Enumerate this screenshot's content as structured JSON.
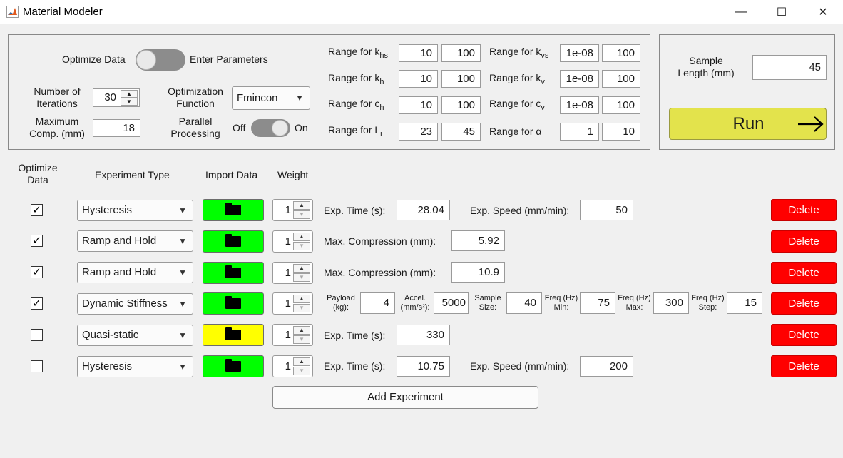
{
  "window": {
    "title": "Material Modeler",
    "min": "—",
    "max": "☐",
    "close": "✕"
  },
  "settings": {
    "mode_toggle": {
      "left_label": "Optimize Data",
      "right_label": "Enter Parameters"
    },
    "iterations": {
      "label_1": "Number of",
      "label_2": "Iterations",
      "value": "30"
    },
    "max_comp": {
      "label_1": "Maximum",
      "label_2": "Comp. (mm)",
      "value": "18"
    },
    "opt_function": {
      "label_1": "Optimization",
      "label_2": "Function",
      "value": "Fmincon"
    },
    "parallel": {
      "label_1": "Parallel",
      "label_2": "Processing",
      "off": "Off",
      "on": "On"
    }
  },
  "ranges": [
    {
      "label": "Range for k",
      "sub": "hs",
      "min": "10",
      "max": "100"
    },
    {
      "label": "Range for k",
      "sub": "h",
      "min": "10",
      "max": "100"
    },
    {
      "label": "Range for c",
      "sub": "h",
      "min": "10",
      "max": "100"
    },
    {
      "label": "Range for L",
      "sub": "i",
      "min": "23",
      "max": "45"
    },
    {
      "label": "Range for k",
      "sub": "vs",
      "min": "1e-08",
      "max": "100"
    },
    {
      "label": "Range for k",
      "sub": "v",
      "min": "1e-08",
      "max": "100"
    },
    {
      "label": "Range for c",
      "sub": "v",
      "min": "1e-08",
      "max": "100"
    },
    {
      "label": "Range for α",
      "sub": "",
      "min": "1",
      "max": "10"
    }
  ],
  "sample": {
    "label_1": "Sample",
    "label_2": "Length (mm)",
    "value": "45"
  },
  "run": {
    "label": "Run",
    "arrow": "→"
  },
  "table_headers": {
    "optimize_1": "Optimize",
    "optimize_2": "Data",
    "type": "Experiment Type",
    "import": "Import Data",
    "weight": "Weight"
  },
  "experiments": [
    {
      "checked": "✓",
      "type": "Hysteresis",
      "weight": "1",
      "color": "#00ff00",
      "params": [
        {
          "label": "Exp. Time (s):",
          "value": "28.04"
        },
        {
          "label": "Exp. Speed (mm/min):",
          "value": "50"
        }
      ],
      "delete": "Delete"
    },
    {
      "checked": "✓",
      "type": "Ramp and Hold",
      "weight": "1",
      "color": "#00ff00",
      "params": [
        {
          "label": "Max. Compression (mm):",
          "value": "5.92"
        }
      ],
      "delete": "Delete"
    },
    {
      "checked": "✓",
      "type": "Ramp and Hold",
      "weight": "1",
      "color": "#00ff00",
      "params": [
        {
          "label": "Max. Compression (mm):",
          "value": "10.9"
        }
      ],
      "delete": "Delete"
    },
    {
      "checked": "✓",
      "type": "Dynamic Stiffness",
      "weight": "1",
      "color": "#00ff00",
      "params": [
        {
          "label_1": "Payload",
          "label_2": "(kg):",
          "value": "4"
        },
        {
          "label_1": "Accel.",
          "label_2": "(mm/s²):",
          "value": "5000"
        },
        {
          "label_1": "Sample",
          "label_2": "Size:",
          "value": "40"
        },
        {
          "label_1": "Freq (Hz)",
          "label_2": "Min:",
          "value": "75"
        },
        {
          "label_1": "Freq (Hz)",
          "label_2": "Max:",
          "value": "300"
        },
        {
          "label_1": "Freq (Hz)",
          "label_2": "Step:",
          "value": "15"
        }
      ],
      "delete": "Delete"
    },
    {
      "checked": "",
      "type": "Quasi-static",
      "weight": "1",
      "color": "#ffff00",
      "params": [
        {
          "label": "Exp. Time (s):",
          "value": "330"
        }
      ],
      "delete": "Delete"
    },
    {
      "checked": "",
      "type": "Hysteresis",
      "weight": "1",
      "color": "#00ff00",
      "params": [
        {
          "label": "Exp. Time (s):",
          "value": "10.75"
        },
        {
          "label": "Exp. Speed (mm/min):",
          "value": "200"
        }
      ],
      "delete": "Delete"
    }
  ],
  "add_experiment": "Add Experiment",
  "icons": {
    "folder": "folder-icon",
    "dropdown": "▼",
    "up": "▲",
    "down": "▼"
  }
}
